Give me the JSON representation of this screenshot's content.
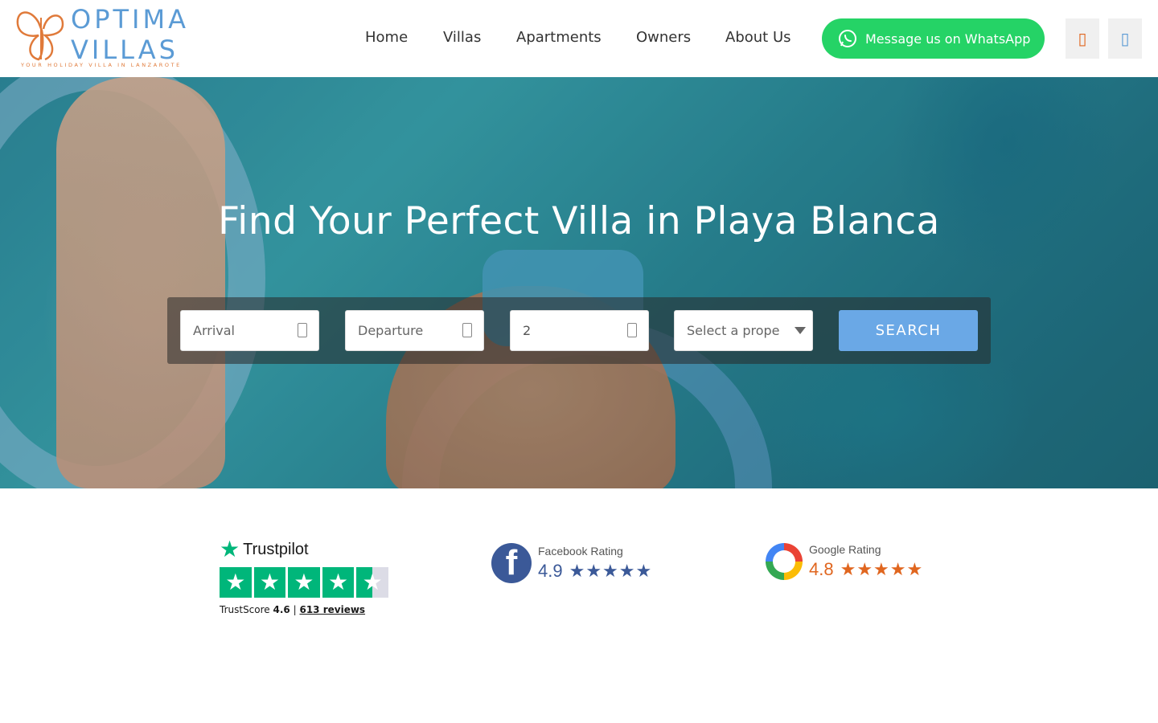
{
  "brand": {
    "name_line1": "OPTIMA",
    "name_line2": "VILLAS",
    "tagline": "YOUR HOLIDAY VILLA IN LANZAROTE",
    "primary_color": "#5b9bd5",
    "accent_color": "#e07a3a"
  },
  "nav": {
    "items": [
      {
        "label": "Home"
      },
      {
        "label": "Villas"
      },
      {
        "label": "Apartments"
      },
      {
        "label": "Owners"
      },
      {
        "label": "About Us"
      }
    ]
  },
  "header_actions": {
    "whatsapp_label": "Message us on WhatsApp",
    "whatsapp_color": "#25d366",
    "icon_one": "phone-icon",
    "icon_two": "email-icon"
  },
  "hero": {
    "title": "Find Your Perfect Villa in Playa Blanca"
  },
  "search": {
    "arrival_placeholder": "Arrival",
    "departure_placeholder": "Departure",
    "guests_value": "2",
    "property_placeholder": "Select a prope",
    "button_label": "SEARCH",
    "button_color": "#6aa8e6"
  },
  "ratings": {
    "trustpilot": {
      "brand": "Trustpilot",
      "score_label": "TrustScore",
      "score": "4.6",
      "separator": "|",
      "reviews": "613 reviews",
      "stars": 4.5
    },
    "facebook": {
      "label": "Facebook Rating",
      "score": "4.9",
      "stars": "★★★★★"
    },
    "google": {
      "label": "Google Rating",
      "score": "4.8",
      "stars": "★★★★★"
    }
  }
}
